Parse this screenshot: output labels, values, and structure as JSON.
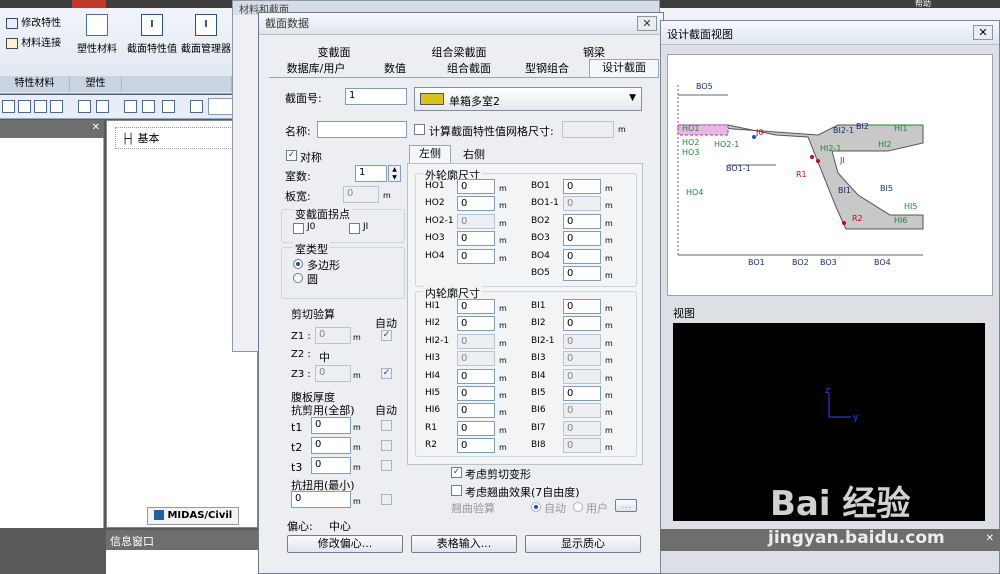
{
  "ribbon": {
    "tabs": [
      "...",
      "...",
      "...",
      "...",
      "..."
    ],
    "items": {
      "modify_props": "修改特性",
      "material_link": "材料连接",
      "plastic_material": "塑性材料",
      "section_props_value": "截面特性值",
      "section_manager": "截面管理器"
    },
    "groups": {
      "prop_material": "特性材料",
      "plastic": "塑性"
    },
    "top_right": "帮助"
  },
  "left_panel": {
    "tree_root": "基本",
    "bottom_tab": "MIDAS/Civil",
    "info_window": "信息窗口"
  },
  "bg_window": {
    "title": "材料和截面"
  },
  "dialog": {
    "title": "截面数据",
    "tabs_row1": [
      "变截面",
      "组合梁截面",
      "钢梁"
    ],
    "tabs_row2": [
      "数据库/用户",
      "数值",
      "组合截面",
      "型钢组合",
      "设计截面"
    ],
    "active_tab": "设计截面",
    "section_no_label": "截面号:",
    "section_no": "1",
    "section_type": "单箱多室2",
    "name_label": "名称:",
    "name_value": "",
    "calc_mesh_label": "计算截面特性值网格尺寸:",
    "unit_m": "m",
    "symmetric_label": "对称",
    "cells_label": "室数:",
    "cells_value": "1",
    "web_width_label": "板宽:",
    "web_width_value": "0",
    "var_point_group": "变截面拐点",
    "j0_label": "J0",
    "ji_label": "JI",
    "cell_type_group": "室类型",
    "polygon_label": "多边形",
    "circle_label": "圆",
    "shear_group": "剪切验算",
    "auto_label": "自动",
    "z1_label": "Z1 :",
    "z1_value": "0",
    "z2_label": "Z2 :",
    "z2_value": "中",
    "z3_label": "Z3 :",
    "z3_value": "0",
    "web_thick_group": "腹板厚度",
    "shear_all_label": "抗剪用(全部)",
    "auto2_label": "自动",
    "t1_label": "t1",
    "t1_value": "0",
    "t2_label": "t2",
    "t2_value": "0",
    "t3_label": "t3",
    "t3_value": "0",
    "torsion_label": "抗扭用(最小)",
    "torsion_value": "0",
    "side_tabs": [
      "左侧",
      "右侧"
    ],
    "outer_group": "外轮廓尺寸",
    "outer_left": [
      {
        "label": "HO1",
        "value": "0",
        "disabled": false
      },
      {
        "label": "HO2",
        "value": "0",
        "disabled": false
      },
      {
        "label": "HO2-1",
        "value": "0",
        "disabled": true
      },
      {
        "label": "HO3",
        "value": "0",
        "disabled": false
      },
      {
        "label": "HO4",
        "value": "0",
        "disabled": false
      }
    ],
    "outer_right": [
      {
        "label": "BO1",
        "value": "0",
        "disabled": false
      },
      {
        "label": "BO1-1",
        "value": "0",
        "disabled": true
      },
      {
        "label": "BO2",
        "value": "0",
        "disabled": false
      },
      {
        "label": "BO3",
        "value": "0",
        "disabled": false
      },
      {
        "label": "BO4",
        "value": "0",
        "disabled": false
      },
      {
        "label": "BO5",
        "value": "0",
        "disabled": false
      }
    ],
    "inner_group": "内轮廓尺寸",
    "inner_left": [
      {
        "label": "HI1",
        "value": "0",
        "disabled": false
      },
      {
        "label": "HI2",
        "value": "0",
        "disabled": false
      },
      {
        "label": "HI2-1",
        "value": "0",
        "disabled": true
      },
      {
        "label": "HI3",
        "value": "0",
        "disabled": true
      },
      {
        "label": "HI4",
        "value": "0",
        "disabled": false
      },
      {
        "label": "HI5",
        "value": "0",
        "disabled": false
      },
      {
        "label": "HI6",
        "value": "0",
        "disabled": false
      },
      {
        "label": "R1",
        "value": "0",
        "disabled": false
      },
      {
        "label": "R2",
        "value": "0",
        "disabled": false
      }
    ],
    "inner_right": [
      {
        "label": "BI1",
        "value": "0",
        "disabled": false
      },
      {
        "label": "BI2",
        "value": "0",
        "disabled": false
      },
      {
        "label": "BI2-1",
        "value": "0",
        "disabled": true
      },
      {
        "label": "BI3",
        "value": "0",
        "disabled": true
      },
      {
        "label": "BI4",
        "value": "0",
        "disabled": true
      },
      {
        "label": "BI5",
        "value": "0",
        "disabled": false
      },
      {
        "label": "BI6",
        "value": "0",
        "disabled": true
      },
      {
        "label": "BI7",
        "value": "0",
        "disabled": true
      },
      {
        "label": "BI8",
        "value": "0",
        "disabled": true
      }
    ],
    "consider_shear": "考虑剪切变形",
    "consider_warping": "考虑翘曲效果(7自由度)",
    "warping_check": "翘曲验算",
    "auto_radio": "自动",
    "user_radio": "用户",
    "eccentric_label": "偏心:",
    "eccentric_value": "中心",
    "btn_modify_ecc": "修改偏心...",
    "btn_table_input": "表格输入...",
    "btn_show_centroid": "显示质心"
  },
  "design_view": {
    "title": "设计截面视图",
    "labels": [
      "BO5",
      "HO1",
      "HO2",
      "HO2-1",
      "HO3",
      "HO4",
      "BO1-1",
      "J0",
      "BI2-1",
      "BI2",
      "HI1",
      "HI2",
      "HI2-1",
      "R1",
      "JI",
      "BI1",
      "BI5",
      "HI5",
      "R2",
      "HI6",
      "BO1",
      "BO2",
      "BO3",
      "BO4"
    ]
  },
  "view_panel": {
    "title": "视图",
    "axis_z": "z",
    "axis_y": "y"
  },
  "watermark": {
    "brand": "Bai 经验",
    "url": "jingyan.baidu.com"
  },
  "colors": {
    "accent_red": "#d0021b",
    "dim_green": "#1a8a2a",
    "section_gray": "#c8c8c8"
  }
}
